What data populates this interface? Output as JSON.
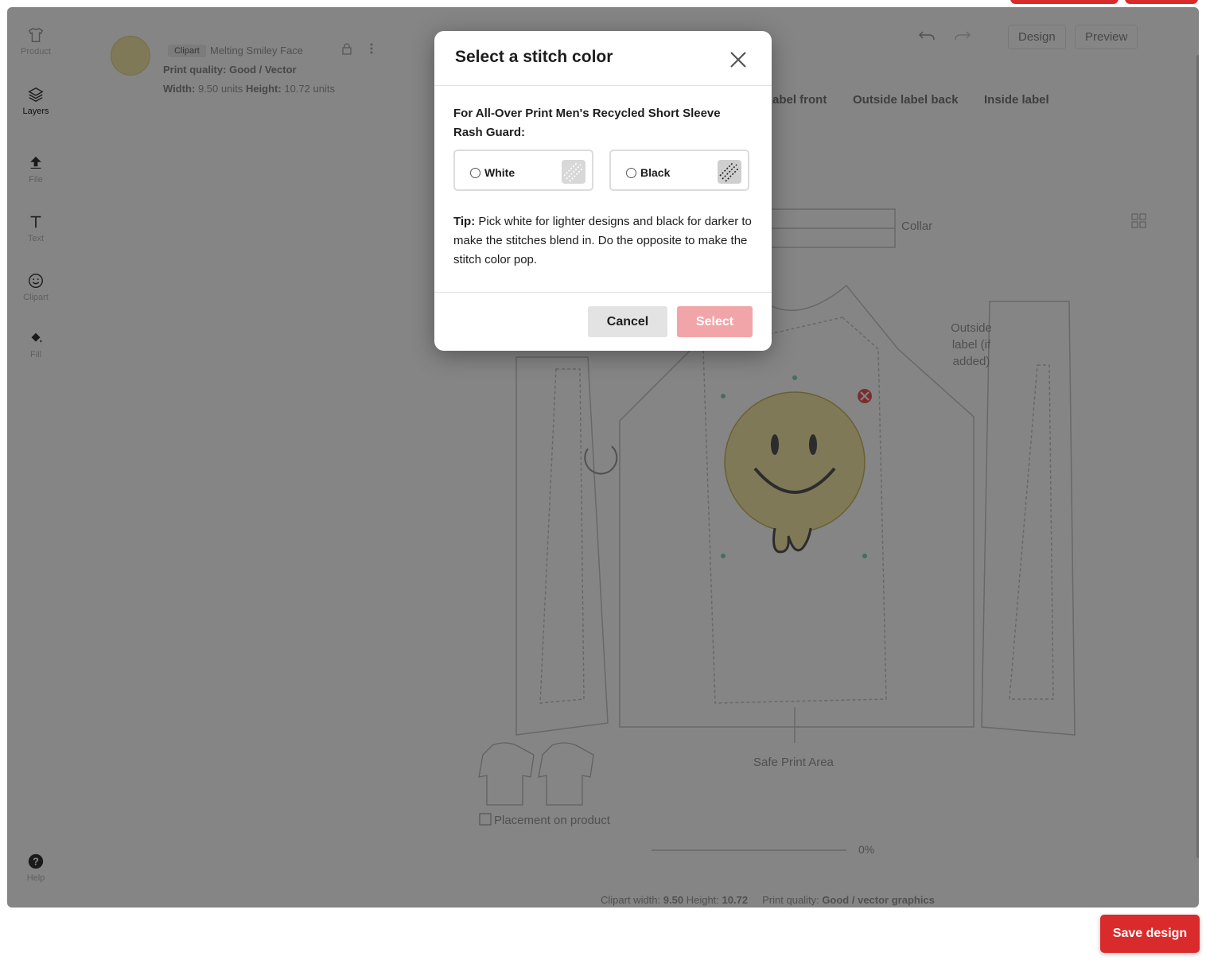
{
  "sidebar": {
    "items": [
      {
        "label": "Product",
        "icon": "shirt-icon"
      },
      {
        "label": "Layers",
        "icon": "layers-icon"
      },
      {
        "label": "File",
        "icon": "upload-icon"
      },
      {
        "label": "Text",
        "icon": "text-icon"
      },
      {
        "label": "Clipart",
        "icon": "smiley-icon"
      },
      {
        "label": "Fill",
        "icon": "paint-bucket-icon"
      }
    ],
    "help": {
      "label": "Help",
      "icon": "help-icon"
    }
  },
  "clipart": {
    "chip": "Clipart",
    "name": "Melting Smiley Face",
    "quality_label": "Print quality:",
    "quality_value": "Good / Vector",
    "width_label": "Width:",
    "width_value": "9.50 units",
    "height_label": "Height:",
    "height_value": "10.72 units"
  },
  "header": {
    "design_tab": "Design",
    "preview_tab": "Preview"
  },
  "placements": [
    "abel front",
    "Outside label back",
    "Inside label"
  ],
  "canvas": {
    "collar_label": "Collar",
    "outside_label": "Outside label (if added)",
    "safe_area_label": "Safe Print Area",
    "placement_checkbox_label": "Placement on product",
    "zoom_value": "0%",
    "status": {
      "width_label": "Clipart width:",
      "width_value": "9.50",
      "height_label": "Height:",
      "height_value": "10.72",
      "quality_label": "Print quality:",
      "quality_value": "Good / vector graphics"
    }
  },
  "modal": {
    "title": "Select a stitch color",
    "product_label": "For All-Over Print Men's Recycled Short Sleeve Rash Guard:",
    "options": [
      {
        "label": "White",
        "swatch_color": "#d8d8d8"
      },
      {
        "label": "Black",
        "swatch_color": "#cfcfcf"
      }
    ],
    "tip_bold": "Tip:",
    "tip_text": " Pick white for lighter designs and black for darker to make the stitches blend in. Do the opposite to make the stitch color pop.",
    "cancel_label": "Cancel",
    "select_label": "Select"
  },
  "save_label": "Save design",
  "colors": {
    "accent": "#d92b2b",
    "select_disabled": "#f2a5a8",
    "overlay": "rgba(0,0,0,0.48)"
  }
}
